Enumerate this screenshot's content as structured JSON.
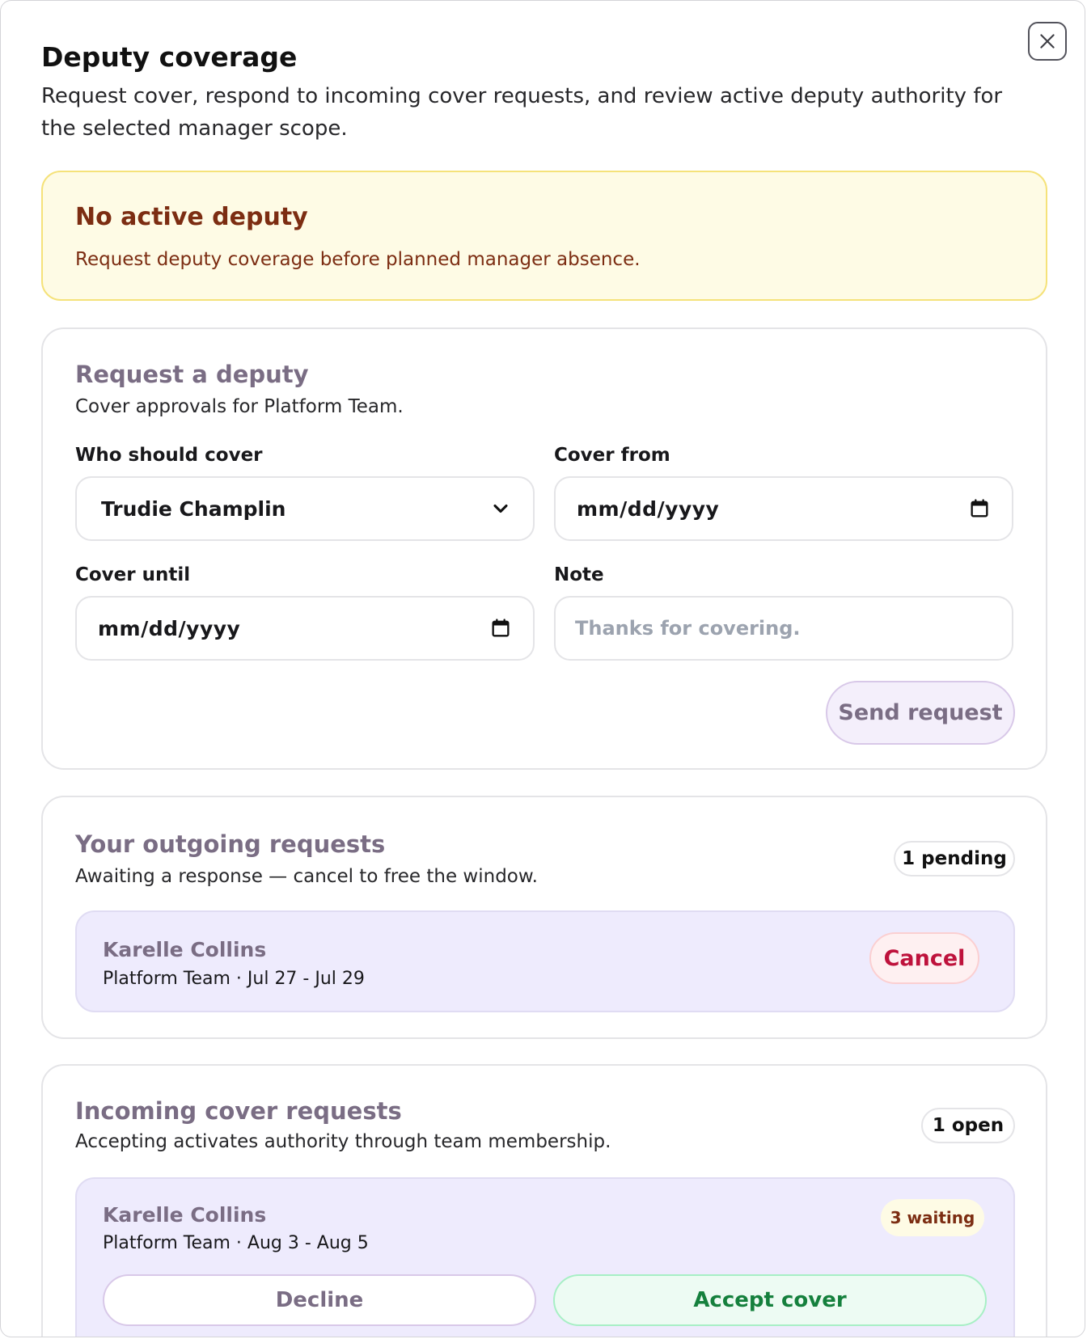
{
  "header": {
    "title": "Deputy coverage",
    "subtitle": "Request cover, respond to incoming cover requests, and review active deputy authority for the selected manager scope.",
    "close_icon": "close-icon"
  },
  "alert": {
    "title": "No active deputy",
    "text": "Request deputy coverage before planned manager absence."
  },
  "request_form": {
    "title": "Request a deputy",
    "subtitle": "Cover approvals for Platform Team.",
    "who_label": "Who should cover",
    "who_value": "Trudie Champlin",
    "from_label": "Cover from",
    "from_value": "mm/dd/yyyy",
    "until_label": "Cover until",
    "until_value": "mm/dd/yyyy",
    "note_label": "Note",
    "note_placeholder": "Thanks for covering.",
    "send_label": "Send request"
  },
  "outgoing": {
    "title": "Your outgoing requests",
    "subtitle": "Awaiting a response — cancel to free the window.",
    "badge": "1 pending",
    "items": [
      {
        "name": "Karelle Collins",
        "meta": "Platform Team · Jul 27 - Jul 29",
        "cancel_label": "Cancel"
      }
    ]
  },
  "incoming": {
    "title": "Incoming cover requests",
    "subtitle": "Accepting activates authority through team membership.",
    "badge": "1 open",
    "items": [
      {
        "name": "Karelle Collins",
        "meta": "Platform Team · Aug 3 - Aug 5",
        "waiting": "3 waiting",
        "decline_label": "Decline",
        "accept_label": "Accept cover"
      }
    ]
  }
}
